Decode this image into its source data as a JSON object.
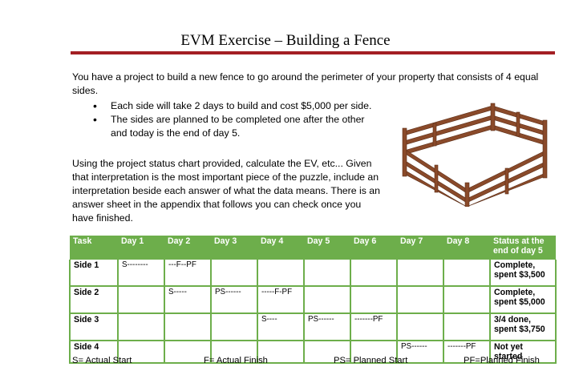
{
  "title": "EVM Exercise – Building a Fence",
  "intro": "You have a project to build a new fence to go around the perimeter of your property that consists of 4 equal sides.",
  "bullets": [
    "Each side will take 2 days to build and cost $5,000 per side.",
    "The sides are planned to be completed one after the other and today is the end of day 5."
  ],
  "paragraph": "Using the project status chart provided, calculate the EV, etc... Given that interpretation is the most important piece of the puzzle, include an interpretation beside each answer of what the data means.  There is an answer sheet in the appendix that follows you can check once you have finished.",
  "table": {
    "headers": [
      "Task",
      "Day 1",
      "Day 2",
      "Day 3",
      "Day 4",
      "Day 5",
      "Day 6",
      "Day 7",
      "Day 8",
      "Status at the end of day 5"
    ],
    "rows": [
      {
        "task": "Side 1",
        "status": "Complete, spent $3,500",
        "cells": [
          "S--------",
          "---F--PF",
          "",
          "",
          "",
          "",
          "",
          ""
        ]
      },
      {
        "task": "Side 2",
        "status": "Complete, spent $5,000",
        "cells": [
          "",
          "S-----",
          "PS------",
          "-----F-PF",
          "",
          "",
          "",
          ""
        ]
      },
      {
        "task": "Side 3",
        "status": "3/4 done, spent $3,750",
        "cells": [
          "",
          "",
          "",
          "S----",
          "PS------",
          "-------PF",
          "",
          ""
        ]
      },
      {
        "task": "Side 4",
        "status": "Not yet started",
        "cells": [
          "",
          "",
          "",
          "",
          "",
          "",
          "PS------",
          "-------PF"
        ]
      }
    ]
  },
  "legend": {
    "actual_start": "S= Actual Start",
    "actual_finish": "F= Actual Finish",
    "planned_start": "PS= Planned Start",
    "planned_finish": "PF=Planned Finish"
  }
}
